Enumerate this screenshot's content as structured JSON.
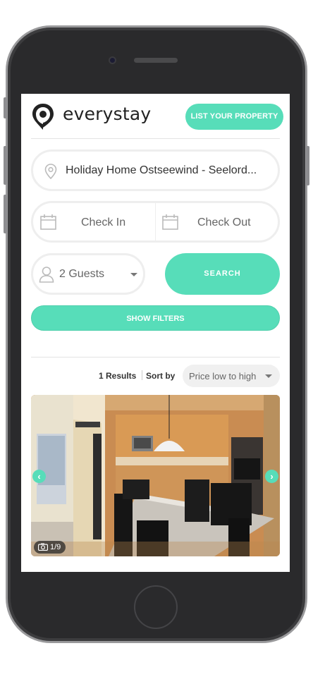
{
  "brand": {
    "name": "everystay",
    "accent_color": "#57ddb9"
  },
  "header": {
    "list_property_label": "LIST YOUR PROPERTY",
    "logo_icon": "location-pin-logo-icon"
  },
  "search": {
    "destination_value": "Holiday Home Ostseewind - Seelord...",
    "destination_icon": "map-pin-icon",
    "check_in_placeholder": "Check In",
    "check_out_placeholder": "Check Out",
    "calendar_icon": "calendar-icon",
    "guests_value": "2 Guests",
    "guests_icon": "user-icon",
    "search_label": "SEARCH",
    "filters_label": "SHOW FILTERS"
  },
  "results": {
    "count_text": "1 Results",
    "sort_by_label": "Sort by",
    "sort_value": "Price low to high"
  },
  "listing": {
    "photo_counter": "1/9",
    "prev_icon": "chevron-left-icon",
    "next_icon": "chevron-right-icon",
    "camera_icon": "camera-icon"
  }
}
